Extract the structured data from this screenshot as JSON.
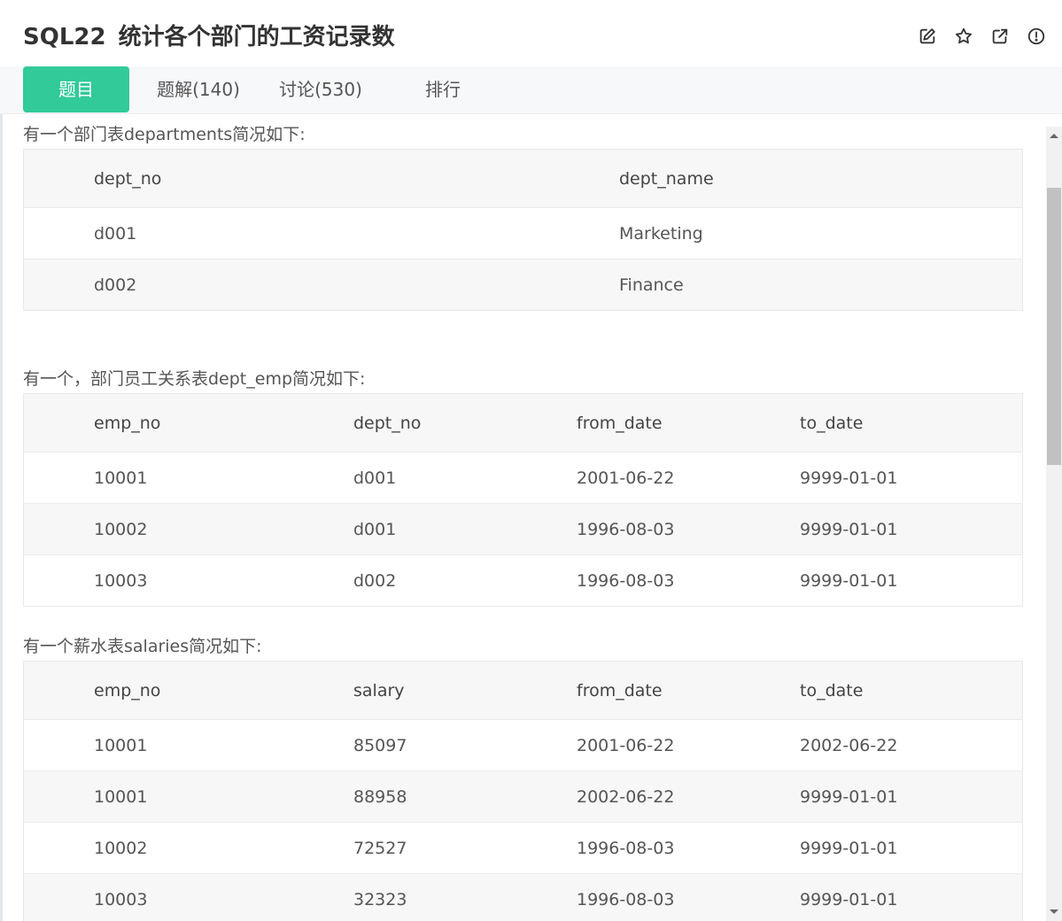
{
  "header": {
    "problem_id": "SQL22",
    "problem_title": "统计各个部门的工资记录数",
    "icons": [
      "edit-icon",
      "star-icon",
      "open-external-icon",
      "info-icon"
    ]
  },
  "tabs": [
    {
      "label": "题目",
      "active": true
    },
    {
      "label": "题解(140)",
      "active": false
    },
    {
      "label": "讨论(530)",
      "active": false
    },
    {
      "label": "排行",
      "active": false
    }
  ],
  "content": {
    "departments": {
      "intro": "有一个部门表departments简况如下:",
      "headers": [
        "dept_no",
        "dept_name"
      ],
      "rows": [
        [
          "d001",
          "Marketing"
        ],
        [
          "d002",
          "Finance"
        ]
      ]
    },
    "dept_emp": {
      "intro": "有一个，部门员工关系表dept_emp简况如下:",
      "headers": [
        "emp_no",
        "dept_no",
        "from_date",
        "to_date"
      ],
      "rows": [
        [
          "10001",
          "d001",
          "2001-06-22",
          "9999-01-01"
        ],
        [
          "10002",
          "d001",
          "1996-08-03",
          "9999-01-01"
        ],
        [
          "10003",
          "d002",
          "1996-08-03",
          "9999-01-01"
        ]
      ]
    },
    "salaries": {
      "intro": "有一个薪水表salaries简况如下:",
      "headers": [
        "emp_no",
        "salary",
        "from_date",
        "to_date"
      ],
      "rows": [
        [
          "10001",
          "85097",
          "2001-06-22",
          "2002-06-22"
        ],
        [
          "10001",
          "88958",
          "2002-06-22",
          "9999-01-01"
        ],
        [
          "10002",
          "72527",
          "1996-08-03",
          "9999-01-01"
        ],
        [
          "10003",
          "32323",
          "1996-08-03",
          "9999-01-01"
        ]
      ]
    }
  },
  "colors": {
    "accent": "#32ca99",
    "tab_bar_bg": "#f7f8fa",
    "table_header_bg": "#f7f7f8"
  }
}
